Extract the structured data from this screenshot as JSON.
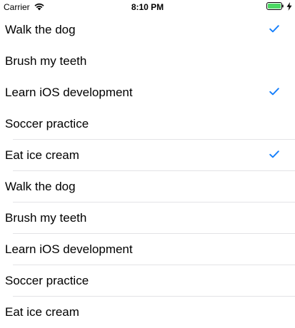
{
  "status_bar": {
    "carrier": "Carrier",
    "time": "8:10 PM",
    "wifi_icon": "wifi-icon",
    "battery_icon": "battery-icon",
    "charging_icon": "bolt-icon",
    "battery_color": "#4cd964"
  },
  "accent_color": "#147efb",
  "items": [
    {
      "label": "Walk the dog",
      "checked": true,
      "separator": false
    },
    {
      "label": "Brush my teeth",
      "checked": false,
      "separator": false
    },
    {
      "label": "Learn iOS development",
      "checked": true,
      "separator": false
    },
    {
      "label": "Soccer practice",
      "checked": false,
      "separator": true
    },
    {
      "label": "Eat ice cream",
      "checked": true,
      "separator": true
    },
    {
      "label": "Walk the dog",
      "checked": false,
      "separator": true
    },
    {
      "label": "Brush my teeth",
      "checked": false,
      "separator": true
    },
    {
      "label": "Learn iOS development",
      "checked": false,
      "separator": true
    },
    {
      "label": "Soccer practice",
      "checked": false,
      "separator": true
    },
    {
      "label": "Eat ice cream",
      "checked": false,
      "separator": false
    }
  ]
}
